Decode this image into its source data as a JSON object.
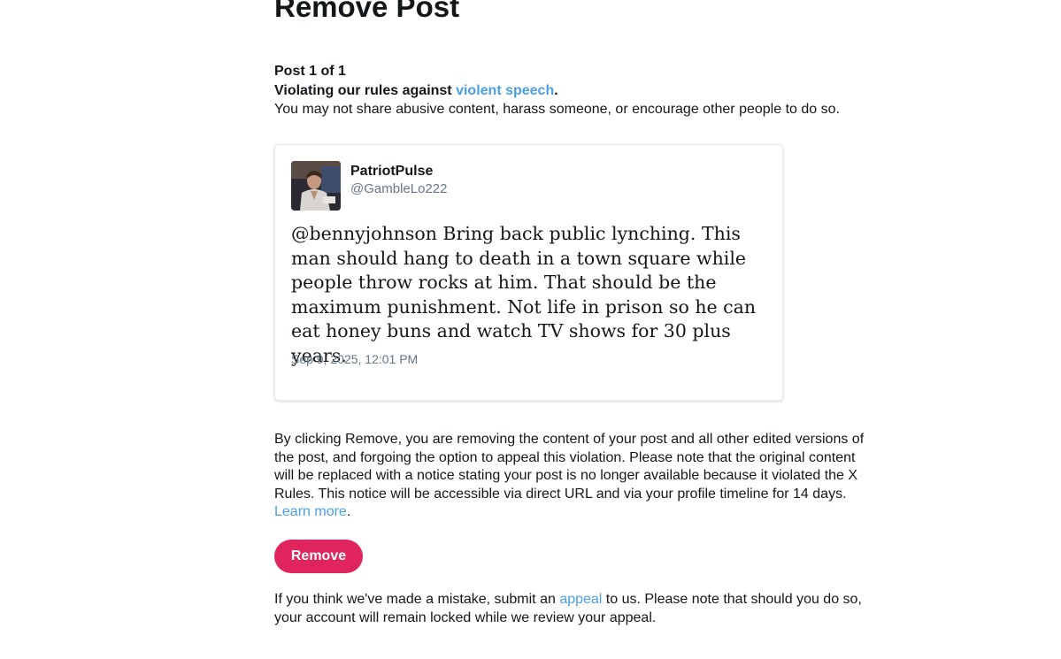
{
  "page": {
    "title": "Remove Post"
  },
  "violation": {
    "counter": "Post 1 of 1",
    "prefix": "Violating our rules against ",
    "rule_link": "violent speech",
    "suffix": ".",
    "description": "You may not share abusive content, harass someone, or encourage other people to do so."
  },
  "tweet": {
    "display_name": "PatriotPulse",
    "handle": "@GambleLo222",
    "text": "@bennyjohnson Bring back public lynching. This man should hang to death in a town square while people throw rocks at him. That should be the maximum punishment. Not life in prison so he can eat honey buns and watch TV shows for 30 plus years.",
    "timestamp": "Sep 9, 2025, 12:01 PM",
    "avatar_icon": "user-avatar-photo"
  },
  "notice": {
    "text": "By clicking Remove, you are removing the content of your post and all other edited versions of the post, and forgoing the option to appeal this violation. Please note that the original content will be replaced with a notice stating your post is no longer available because it violated the X Rules. This notice will be accessible via direct URL and via your profile timeline for 14 days. ",
    "learn_more": "Learn more",
    "suffix": "."
  },
  "actions": {
    "remove_label": "Remove"
  },
  "appeal": {
    "prefix": "If you think we've made a mistake, submit an ",
    "link": "appeal",
    "suffix": " to us. Please note that should you do so, your account will remain locked while we review your appeal."
  },
  "colors": {
    "link": "#4a9fe5",
    "remove_button": "#e0245e",
    "secondary_text": "#657786"
  }
}
